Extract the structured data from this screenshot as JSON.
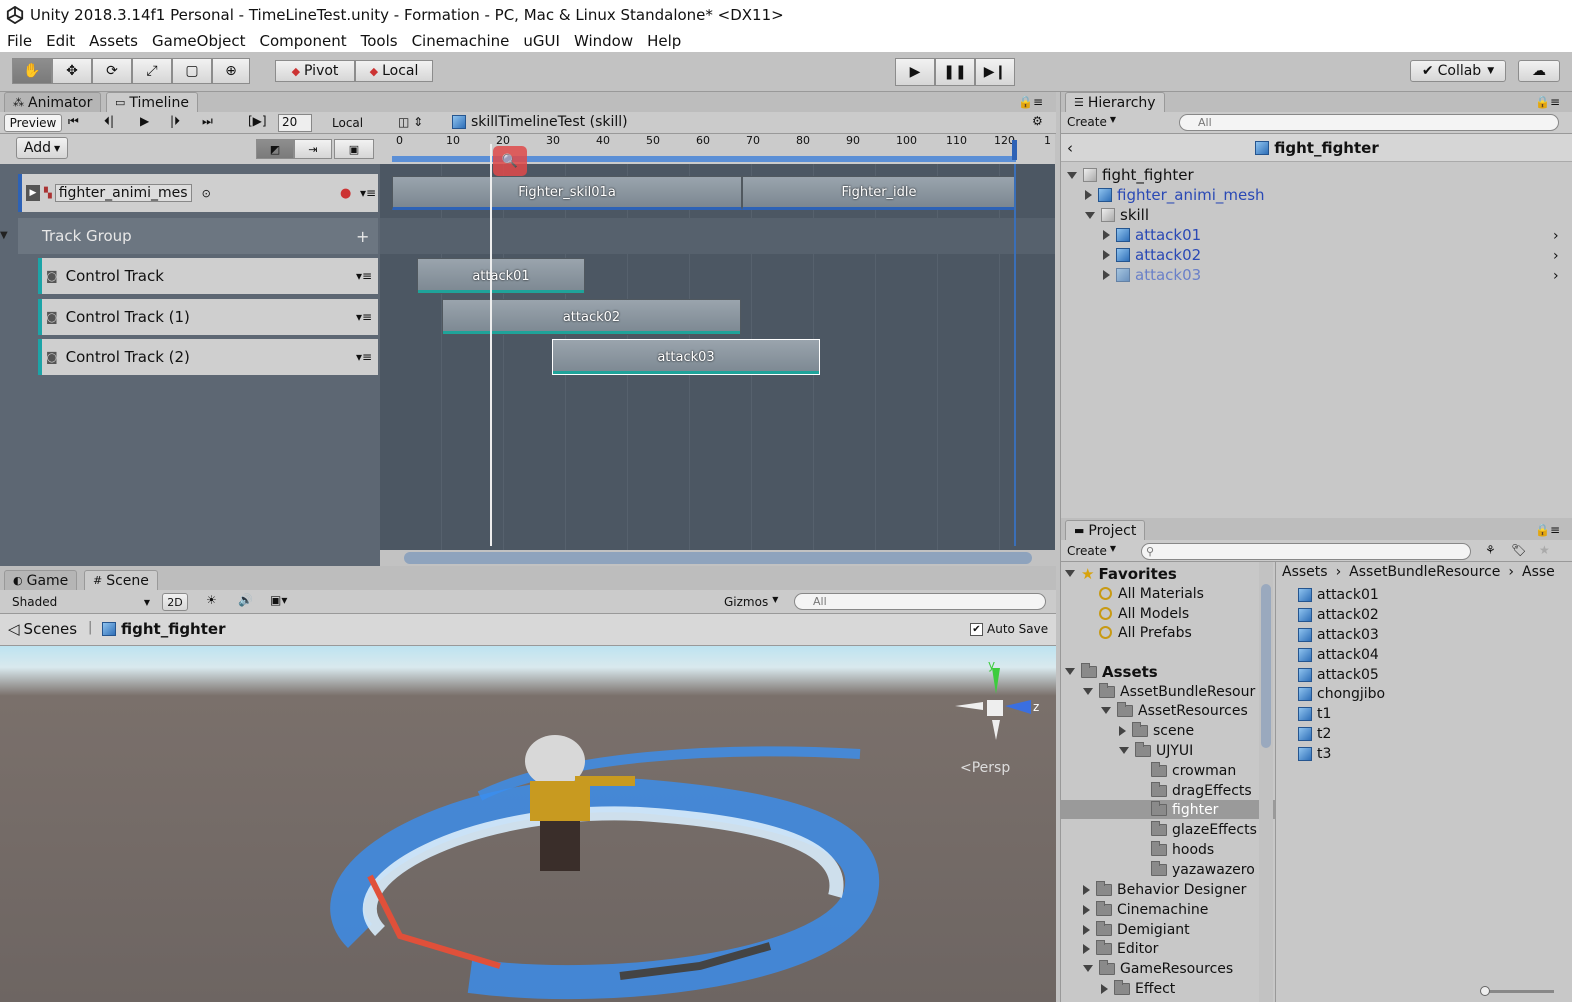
{
  "window": {
    "title": "Unity 2018.3.14f1 Personal - TimeLineTest.unity - Formation - PC, Mac & Linux Standalone* <DX11>"
  },
  "menu": [
    "File",
    "Edit",
    "Assets",
    "GameObject",
    "Component",
    "Tools",
    "Cinemachine",
    "uGUI",
    "Window",
    "Help"
  ],
  "toolbar": {
    "pivot": "Pivot",
    "local": "Local",
    "collab": "Collab"
  },
  "tabs_top": {
    "animator": "Animator",
    "timeline": "Timeline"
  },
  "timeline": {
    "preview": "Preview",
    "frame": "20",
    "local": "Local",
    "add": "Add",
    "asset": "skillTimelineTest (skill)",
    "ruler": [
      "0",
      "10",
      "20",
      "30",
      "40",
      "50",
      "60",
      "70",
      "80",
      "90",
      "100",
      "110",
      "120",
      "1"
    ],
    "anim_track": "fighter_animi_mes",
    "track_group": "Track Group",
    "tracks": [
      "Control Track",
      "Control Track (1)",
      "Control Track (2)"
    ],
    "anim_clips": [
      "Fighter_skil01a",
      "Fighter_idle"
    ],
    "control_clips": [
      "attack01",
      "attack02",
      "attack03"
    ]
  },
  "hierarchy": {
    "tab": "Hierarchy",
    "create": "Create",
    "search_placeholder": "All",
    "root": "fight_fighter",
    "items": [
      "fight_fighter",
      "fighter_animi_mesh",
      "skill",
      "attack01",
      "attack02",
      "attack03"
    ]
  },
  "project": {
    "tab": "Project",
    "create": "Create",
    "favorites": "Favorites",
    "fav_items": [
      "All Materials",
      "All Models",
      "All Prefabs"
    ],
    "assets": "Assets",
    "tree": [
      "AssetBundleResour",
      "AssetResources",
      "scene",
      "UJYUI",
      "crowman",
      "dragEffects",
      "fighter",
      "glazeEffects",
      "hoods",
      "yazawazero",
      "Behavior Designer",
      "Cinemachine",
      "Demigiant",
      "Editor",
      "GameResources",
      "Effect"
    ],
    "breadcrumb": [
      "Assets",
      "AssetBundleResource",
      "Asse"
    ],
    "files": [
      "attack01",
      "attack02",
      "attack03",
      "attack04",
      "attack05",
      "chongjibo",
      "t1",
      "t2",
      "t3"
    ]
  },
  "scene": {
    "tab_game": "Game",
    "tab_scene": "Scene",
    "shaded": "Shaded",
    "mode2d": "2D",
    "gizmos": "Gizmos",
    "search_placeholder": "All",
    "scenes": "Scenes",
    "object": "fight_fighter",
    "autosave": "Auto Save",
    "persp": "Persp",
    "axis_y": "y",
    "axis_z": "z"
  }
}
